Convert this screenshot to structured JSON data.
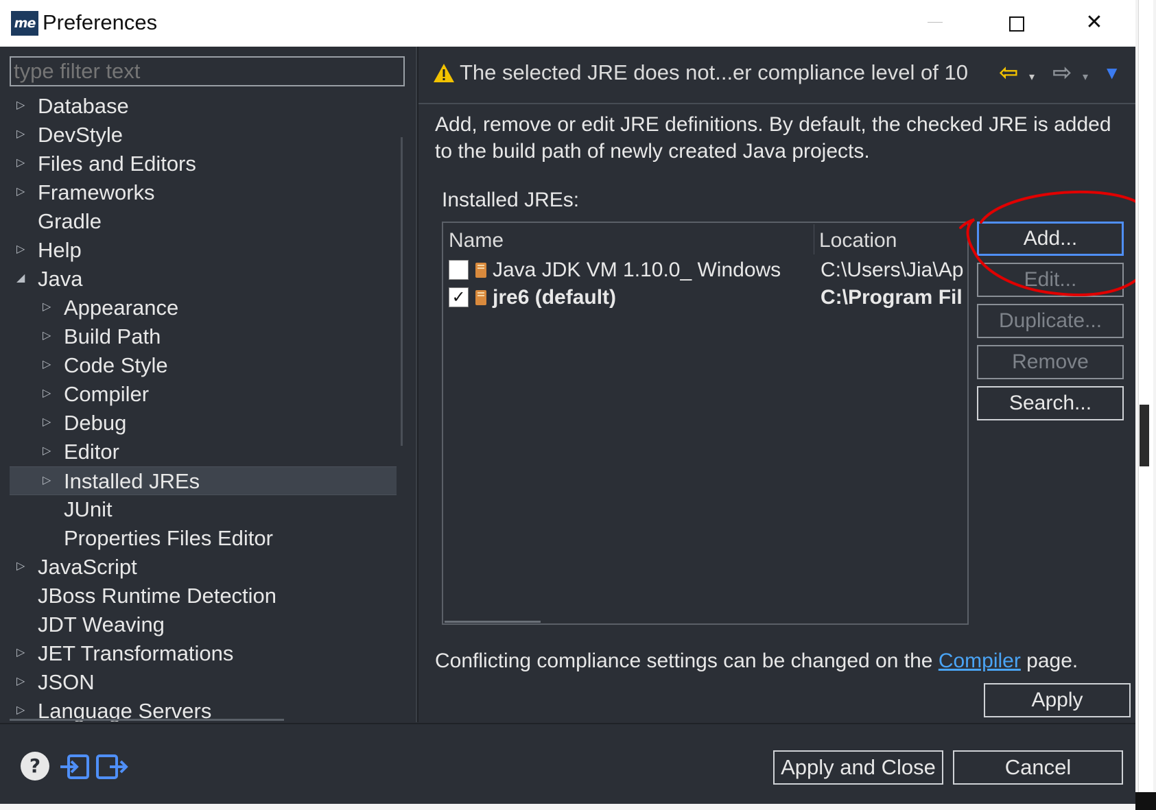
{
  "window": {
    "title": "Preferences",
    "app_icon_text": "me",
    "minimize_icon": "minimize-icon",
    "maximize_icon": "maximize-icon",
    "close_icon": "close-icon",
    "close_glyph": "✕"
  },
  "filter": {
    "placeholder": "type filter text",
    "value": ""
  },
  "tree": {
    "items": [
      {
        "label": "Database",
        "level": 0,
        "arrow": "▷"
      },
      {
        "label": "DevStyle",
        "level": 0,
        "arrow": "▷"
      },
      {
        "label": "Files and Editors",
        "level": 0,
        "arrow": "▷"
      },
      {
        "label": "Frameworks",
        "level": 0,
        "arrow": "▷"
      },
      {
        "label": "Gradle",
        "level": 0,
        "arrow": ""
      },
      {
        "label": "Help",
        "level": 0,
        "arrow": "▷"
      },
      {
        "label": "Java",
        "level": 0,
        "arrow": "◢"
      },
      {
        "label": "Appearance",
        "level": 1,
        "arrow": "▷"
      },
      {
        "label": "Build Path",
        "level": 1,
        "arrow": "▷"
      },
      {
        "label": "Code Style",
        "level": 1,
        "arrow": "▷"
      },
      {
        "label": "Compiler",
        "level": 1,
        "arrow": "▷"
      },
      {
        "label": "Debug",
        "level": 1,
        "arrow": "▷"
      },
      {
        "label": "Editor",
        "level": 1,
        "arrow": "▷"
      },
      {
        "label": "Installed JREs",
        "level": 1,
        "arrow": "▷",
        "selected": true
      },
      {
        "label": "JUnit",
        "level": 1,
        "arrow": ""
      },
      {
        "label": "Properties Files Editor",
        "level": 1,
        "arrow": ""
      },
      {
        "label": "JavaScript",
        "level": 0,
        "arrow": "▷"
      },
      {
        "label": "JBoss Runtime Detection",
        "level": 0,
        "arrow": ""
      },
      {
        "label": "JDT Weaving",
        "level": 0,
        "arrow": ""
      },
      {
        "label": "JET Transformations",
        "level": 0,
        "arrow": "▷"
      },
      {
        "label": "JSON",
        "level": 0,
        "arrow": "▷"
      },
      {
        "label": "Language Servers",
        "level": 0,
        "arrow": "▷"
      }
    ]
  },
  "header": {
    "message": "The selected JRE does not...er compliance level of 10",
    "warning_icon": "warning-icon",
    "back_glyph": "⇦",
    "forward_glyph": "⇨",
    "dropdown_glyph": "▾",
    "view_menu_glyph": "▼"
  },
  "page": {
    "description": "Add, remove or edit JRE definitions. By default, the checked JRE is added to the build path of newly created Java projects.",
    "installed_label": "Installed JREs:",
    "table": {
      "columns": [
        "Name",
        "Location"
      ],
      "rows": [
        {
          "checked": false,
          "name": "Java JDK VM 1.10.0_ Windows",
          "location": "C:\\Users\\Jia\\Ap",
          "bold": false
        },
        {
          "checked": true,
          "name": "jre6 (default)",
          "location": "C:\\Program Fil",
          "bold": true
        }
      ]
    },
    "buttons": {
      "add": "Add...",
      "edit": "Edit...",
      "duplicate": "Duplicate...",
      "remove": "Remove",
      "search": "Search..."
    },
    "compliance_prefix": "Conflicting compliance settings can be changed on the ",
    "compliance_link": "Compiler",
    "compliance_suffix": " page.",
    "apply": "Apply"
  },
  "footer": {
    "help_glyph": "?",
    "apply_and_close": "Apply and Close",
    "cancel": "Cancel"
  },
  "colors": {
    "background": "#2b2f36",
    "link": "#4aa4f5",
    "warning": "#f2c200",
    "annotation": "#e00000"
  }
}
